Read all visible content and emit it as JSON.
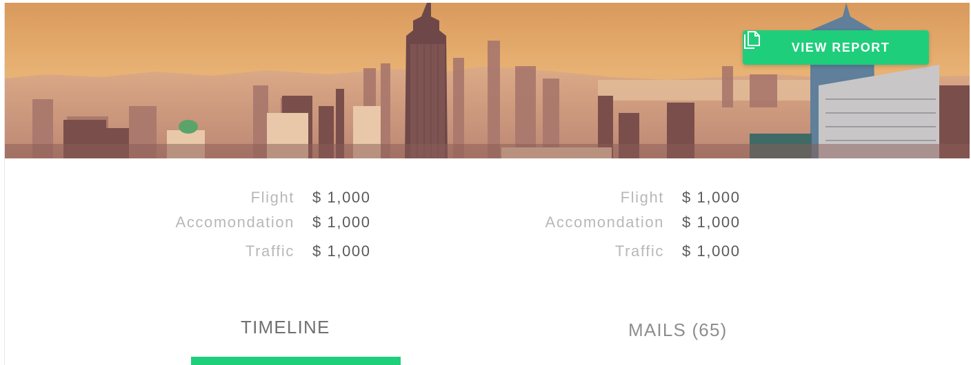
{
  "hero": {
    "image_description": "city skyline panorama",
    "report_button": {
      "label": "VIEW REPORT",
      "icon": "document-copy-icon"
    }
  },
  "cost_summaries": [
    {
      "rows": [
        {
          "label": "Flight",
          "value": "$ 1,000"
        },
        {
          "label": "Accomondation",
          "value": "$ 1,000"
        },
        {
          "label": "Traffic",
          "value": "$ 1,000"
        }
      ]
    },
    {
      "rows": [
        {
          "label": "Flight",
          "value": "$ 1,000"
        },
        {
          "label": "Accomondation",
          "value": "$ 1,000"
        },
        {
          "label": "Traffic",
          "value": "$ 1,000"
        }
      ]
    }
  ],
  "tabs": [
    {
      "label": "TIMELINE",
      "active": true
    },
    {
      "label": "MAILS (65)",
      "active": false
    }
  ],
  "colors": {
    "accent": "#1fce7b",
    "label_text": "#b8b8b8",
    "value_text": "#5a5a5a"
  }
}
